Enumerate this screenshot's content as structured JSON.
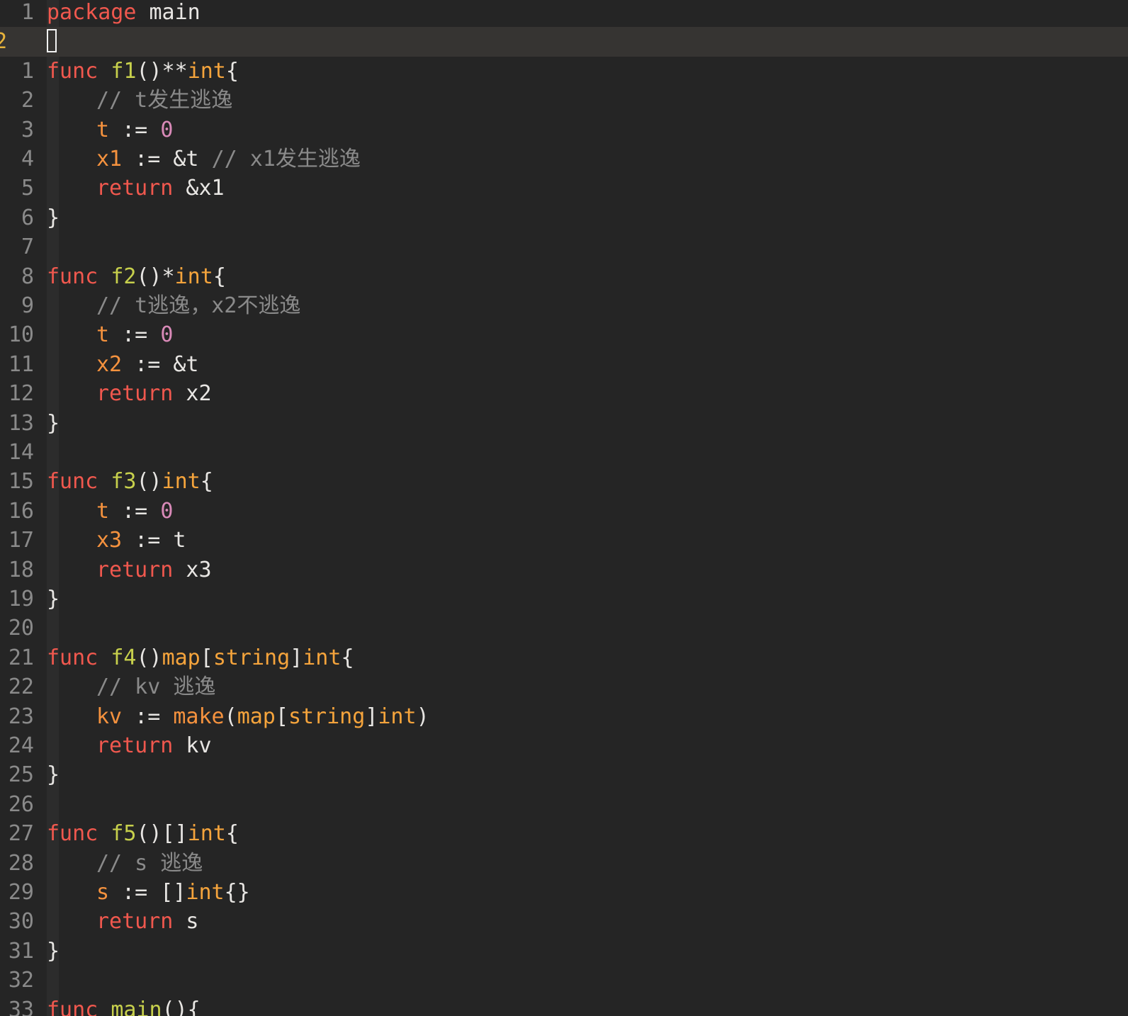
{
  "editor": {
    "language": "go",
    "current_line_label": "2",
    "colors": {
      "background": "#252525",
      "keyword": "#f0584e",
      "function": "#c7d04c",
      "type": "#f5a43c",
      "variable": "#f5923e",
      "number": "#d98ab8",
      "comment": "#8a8a8a",
      "plain": "#e8e6e3",
      "current_line_number": "#e8b33b"
    },
    "lines": [
      {
        "num": "1",
        "indent": 0,
        "tokens": [
          {
            "t": "kw",
            "v": "package"
          },
          {
            "t": "pl",
            "v": " main"
          }
        ]
      },
      {
        "num": "2",
        "indent": 0,
        "current": true,
        "tokens": []
      },
      {
        "num": "1",
        "indent": 0,
        "tokens": [
          {
            "t": "kw",
            "v": "func"
          },
          {
            "t": "pl",
            "v": " "
          },
          {
            "t": "fn",
            "v": "f1"
          },
          {
            "t": "pl",
            "v": "()**"
          },
          {
            "t": "ty",
            "v": "int"
          },
          {
            "t": "pl",
            "v": "{"
          }
        ]
      },
      {
        "num": "2",
        "indent": 1,
        "tokens": [
          {
            "t": "cm",
            "v": "// t发生逃逸"
          }
        ]
      },
      {
        "num": "3",
        "indent": 1,
        "tokens": [
          {
            "t": "var",
            "v": "t"
          },
          {
            "t": "pl",
            "v": " := "
          },
          {
            "t": "num",
            "v": "0"
          }
        ]
      },
      {
        "num": "4",
        "indent": 1,
        "tokens": [
          {
            "t": "var",
            "v": "x1"
          },
          {
            "t": "pl",
            "v": " := &t "
          },
          {
            "t": "cm",
            "v": "// x1发生逃逸"
          }
        ]
      },
      {
        "num": "5",
        "indent": 1,
        "tokens": [
          {
            "t": "kw",
            "v": "return"
          },
          {
            "t": "pl",
            "v": " &x1"
          }
        ]
      },
      {
        "num": "6",
        "indent": 0,
        "tokens": [
          {
            "t": "pl",
            "v": "}"
          }
        ]
      },
      {
        "num": "7",
        "indent": 0,
        "tokens": []
      },
      {
        "num": "8",
        "indent": 0,
        "tokens": [
          {
            "t": "kw",
            "v": "func"
          },
          {
            "t": "pl",
            "v": " "
          },
          {
            "t": "fn",
            "v": "f2"
          },
          {
            "t": "pl",
            "v": "()*"
          },
          {
            "t": "ty",
            "v": "int"
          },
          {
            "t": "pl",
            "v": "{"
          }
        ]
      },
      {
        "num": "9",
        "indent": 1,
        "tokens": [
          {
            "t": "cm",
            "v": "// t逃逸，x2不逃逸"
          }
        ]
      },
      {
        "num": "10",
        "indent": 1,
        "tokens": [
          {
            "t": "var",
            "v": "t"
          },
          {
            "t": "pl",
            "v": " := "
          },
          {
            "t": "num",
            "v": "0"
          }
        ]
      },
      {
        "num": "11",
        "indent": 1,
        "tokens": [
          {
            "t": "var",
            "v": "x2"
          },
          {
            "t": "pl",
            "v": " := &t"
          }
        ]
      },
      {
        "num": "12",
        "indent": 1,
        "tokens": [
          {
            "t": "kw",
            "v": "return"
          },
          {
            "t": "pl",
            "v": " x2"
          }
        ]
      },
      {
        "num": "13",
        "indent": 0,
        "tokens": [
          {
            "t": "pl",
            "v": "}"
          }
        ]
      },
      {
        "num": "14",
        "indent": 0,
        "tokens": []
      },
      {
        "num": "15",
        "indent": 0,
        "tokens": [
          {
            "t": "kw",
            "v": "func"
          },
          {
            "t": "pl",
            "v": " "
          },
          {
            "t": "fn",
            "v": "f3"
          },
          {
            "t": "pl",
            "v": "()"
          },
          {
            "t": "ty",
            "v": "int"
          },
          {
            "t": "pl",
            "v": "{"
          }
        ]
      },
      {
        "num": "16",
        "indent": 1,
        "tokens": [
          {
            "t": "var",
            "v": "t"
          },
          {
            "t": "pl",
            "v": " := "
          },
          {
            "t": "num",
            "v": "0"
          }
        ]
      },
      {
        "num": "17",
        "indent": 1,
        "tokens": [
          {
            "t": "var",
            "v": "x3"
          },
          {
            "t": "pl",
            "v": " := t"
          }
        ]
      },
      {
        "num": "18",
        "indent": 1,
        "tokens": [
          {
            "t": "kw",
            "v": "return"
          },
          {
            "t": "pl",
            "v": " x3"
          }
        ]
      },
      {
        "num": "19",
        "indent": 0,
        "tokens": [
          {
            "t": "pl",
            "v": "}"
          }
        ]
      },
      {
        "num": "20",
        "indent": 0,
        "tokens": []
      },
      {
        "num": "21",
        "indent": 0,
        "tokens": [
          {
            "t": "kw",
            "v": "func"
          },
          {
            "t": "pl",
            "v": " "
          },
          {
            "t": "fn",
            "v": "f4"
          },
          {
            "t": "pl",
            "v": "()"
          },
          {
            "t": "ty",
            "v": "map"
          },
          {
            "t": "pl",
            "v": "["
          },
          {
            "t": "ty",
            "v": "string"
          },
          {
            "t": "pl",
            "v": "]"
          },
          {
            "t": "ty",
            "v": "int"
          },
          {
            "t": "pl",
            "v": "{"
          }
        ]
      },
      {
        "num": "22",
        "indent": 1,
        "tokens": [
          {
            "t": "cm",
            "v": "// kv 逃逸"
          }
        ]
      },
      {
        "num": "23",
        "indent": 1,
        "tokens": [
          {
            "t": "var",
            "v": "kv"
          },
          {
            "t": "pl",
            "v": " := "
          },
          {
            "t": "bi",
            "v": "make"
          },
          {
            "t": "pl",
            "v": "("
          },
          {
            "t": "ty",
            "v": "map"
          },
          {
            "t": "pl",
            "v": "["
          },
          {
            "t": "ty",
            "v": "string"
          },
          {
            "t": "pl",
            "v": "]"
          },
          {
            "t": "ty",
            "v": "int"
          },
          {
            "t": "pl",
            "v": ")"
          }
        ]
      },
      {
        "num": "24",
        "indent": 1,
        "tokens": [
          {
            "t": "kw",
            "v": "return"
          },
          {
            "t": "pl",
            "v": " kv"
          }
        ]
      },
      {
        "num": "25",
        "indent": 0,
        "tokens": [
          {
            "t": "pl",
            "v": "}"
          }
        ]
      },
      {
        "num": "26",
        "indent": 0,
        "tokens": []
      },
      {
        "num": "27",
        "indent": 0,
        "tokens": [
          {
            "t": "kw",
            "v": "func"
          },
          {
            "t": "pl",
            "v": " "
          },
          {
            "t": "fn",
            "v": "f5"
          },
          {
            "t": "pl",
            "v": "()[]"
          },
          {
            "t": "ty",
            "v": "int"
          },
          {
            "t": "pl",
            "v": "{"
          }
        ]
      },
      {
        "num": "28",
        "indent": 1,
        "tokens": [
          {
            "t": "cm",
            "v": "// s 逃逸"
          }
        ]
      },
      {
        "num": "29",
        "indent": 1,
        "tokens": [
          {
            "t": "var",
            "v": "s"
          },
          {
            "t": "pl",
            "v": " := []"
          },
          {
            "t": "ty",
            "v": "int"
          },
          {
            "t": "pl",
            "v": "{}"
          }
        ]
      },
      {
        "num": "30",
        "indent": 1,
        "tokens": [
          {
            "t": "kw",
            "v": "return"
          },
          {
            "t": "pl",
            "v": " s"
          }
        ]
      },
      {
        "num": "31",
        "indent": 0,
        "tokens": [
          {
            "t": "pl",
            "v": "}"
          }
        ]
      },
      {
        "num": "32",
        "indent": 0,
        "tokens": []
      },
      {
        "num": "33",
        "indent": 0,
        "tokens": [
          {
            "t": "kw",
            "v": "func"
          },
          {
            "t": "pl",
            "v": " "
          },
          {
            "t": "fn",
            "v": "main"
          },
          {
            "t": "pl",
            "v": "(){"
          }
        ]
      }
    ]
  }
}
